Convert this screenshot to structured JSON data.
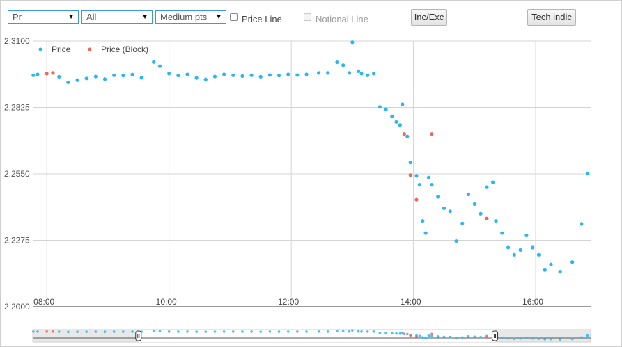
{
  "controls": {
    "field_select": "Pr",
    "filter_select": "All",
    "size_select": "Medium pts",
    "price_line_label": "Price Line",
    "price_line_checked": false,
    "notional_line_label": "Notional Line",
    "notional_line_enabled": false,
    "inc_exc_button": "Inc/Exc",
    "tech_indic_button": "Tech indic"
  },
  "colors": {
    "price": "#29b6f6",
    "block": "#f0645a",
    "accent": "#3a9cd0"
  },
  "chart_data": {
    "type": "scatter",
    "title": "",
    "xlabel": "",
    "ylabel": "",
    "ylim": [
      2.2,
      2.31
    ],
    "xlim": [
      7.77,
      16.9
    ],
    "yticks": [
      "2.3100",
      "2.2825",
      "2.2550",
      "2.2275",
      "2.2000"
    ],
    "xticks": [
      "08:00",
      "10:00",
      "12:00",
      "14:00",
      "16:00"
    ],
    "grid": true,
    "legend_position": "top-left",
    "series": [
      {
        "name": "Price",
        "points": [
          [
            7.78,
            2.2958
          ],
          [
            7.85,
            2.2962
          ],
          [
            8.2,
            2.2952
          ],
          [
            8.35,
            2.2929
          ],
          [
            8.5,
            2.2938
          ],
          [
            8.65,
            2.2945
          ],
          [
            8.8,
            2.2953
          ],
          [
            8.95,
            2.2942
          ],
          [
            9.1,
            2.2958
          ],
          [
            9.25,
            2.2957
          ],
          [
            9.4,
            2.2961
          ],
          [
            9.55,
            2.2948
          ],
          [
            9.75,
            2.3013
          ],
          [
            9.85,
            2.2996
          ],
          [
            10.0,
            2.2965
          ],
          [
            10.15,
            2.2957
          ],
          [
            10.3,
            2.2962
          ],
          [
            10.45,
            2.2947
          ],
          [
            10.6,
            2.2941
          ],
          [
            10.75,
            2.2953
          ],
          [
            10.9,
            2.2962
          ],
          [
            11.05,
            2.2958
          ],
          [
            11.2,
            2.2955
          ],
          [
            11.35,
            2.2958
          ],
          [
            11.5,
            2.2952
          ],
          [
            11.65,
            2.2959
          ],
          [
            11.8,
            2.2957
          ],
          [
            11.95,
            2.2962
          ],
          [
            12.1,
            2.2959
          ],
          [
            12.25,
            2.2962
          ],
          [
            12.45,
            2.2968
          ],
          [
            12.6,
            2.2968
          ],
          [
            12.75,
            2.3012
          ],
          [
            12.85,
            2.3
          ],
          [
            12.95,
            2.2968
          ],
          [
            13.0,
            2.3095
          ],
          [
            13.1,
            2.2975
          ],
          [
            13.15,
            2.2965
          ],
          [
            13.25,
            2.2958
          ],
          [
            13.35,
            2.2965
          ],
          [
            13.45,
            2.2827
          ],
          [
            13.55,
            2.2817
          ],
          [
            13.65,
            2.2788
          ],
          [
            13.72,
            2.2765
          ],
          [
            13.78,
            2.2752
          ],
          [
            13.82,
            2.2838
          ],
          [
            13.9,
            2.2705
          ],
          [
            13.95,
            2.2597
          ],
          [
            14.05,
            2.2542
          ],
          [
            14.1,
            2.2505
          ],
          [
            14.15,
            2.2355
          ],
          [
            14.2,
            2.2305
          ],
          [
            14.25,
            2.2535
          ],
          [
            14.3,
            2.2505
          ],
          [
            14.4,
            2.2455
          ],
          [
            14.5,
            2.2408
          ],
          [
            14.6,
            2.2395
          ],
          [
            14.7,
            2.2272
          ],
          [
            14.8,
            2.2345
          ],
          [
            14.9,
            2.2465
          ],
          [
            15.0,
            2.2425
          ],
          [
            15.1,
            2.2385
          ],
          [
            15.2,
            2.2495
          ],
          [
            15.3,
            2.2515
          ],
          [
            15.35,
            2.2355
          ],
          [
            15.45,
            2.2305
          ],
          [
            15.55,
            2.2245
          ],
          [
            15.65,
            2.2215
          ],
          [
            15.75,
            2.2235
          ],
          [
            15.85,
            2.2295
          ],
          [
            15.95,
            2.2245
          ],
          [
            16.05,
            2.2215
          ],
          [
            16.15,
            2.2152
          ],
          [
            16.25,
            2.2175
          ],
          [
            16.4,
            2.2145
          ],
          [
            16.6,
            2.2185
          ],
          [
            16.75,
            2.2343
          ],
          [
            16.85,
            2.2552
          ]
        ]
      },
      {
        "name": "Price (Block)",
        "points": [
          [
            8.0,
            2.2965
          ],
          [
            8.1,
            2.2968
          ],
          [
            13.85,
            2.2715
          ],
          [
            13.95,
            2.2545
          ],
          [
            14.05,
            2.2443
          ],
          [
            14.3,
            2.2715
          ],
          [
            15.2,
            2.2365
          ]
        ]
      }
    ],
    "navigator": {
      "range_start_time": "09:30",
      "range_end_time": "15:20"
    }
  }
}
